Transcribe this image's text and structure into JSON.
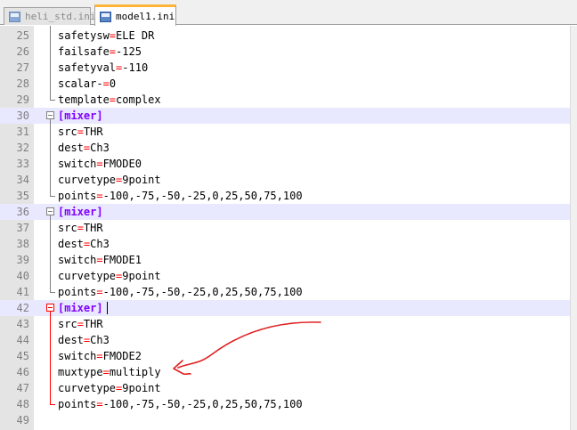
{
  "tabs": [
    {
      "label": "heli_std.ini",
      "active": false,
      "icon": "save-file-icon"
    },
    {
      "label": "model1.ini",
      "active": true,
      "icon": "save-file-icon"
    }
  ],
  "lines": [
    {
      "n": "25",
      "key": "safetysw",
      "val": "ELE DR"
    },
    {
      "n": "26",
      "key": "failsafe",
      "val": "-125"
    },
    {
      "n": "27",
      "key": "safetyval",
      "val": "-110"
    },
    {
      "n": "28",
      "key": "scalar-",
      "val": "0"
    },
    {
      "n": "29",
      "key": "template",
      "val": "complex"
    },
    {
      "n": "30",
      "section": "[mixer]"
    },
    {
      "n": "31",
      "key": "src",
      "val": "THR"
    },
    {
      "n": "32",
      "key": "dest",
      "val": "Ch3"
    },
    {
      "n": "33",
      "key": "switch",
      "val": "FMODE0"
    },
    {
      "n": "34",
      "key": "curvetype",
      "val": "9point"
    },
    {
      "n": "35",
      "key": "points",
      "val": "-100,-75,-50,-25,0,25,50,75,100"
    },
    {
      "n": "36",
      "section": "[mixer]"
    },
    {
      "n": "37",
      "key": "src",
      "val": "THR"
    },
    {
      "n": "38",
      "key": "dest",
      "val": "Ch3"
    },
    {
      "n": "39",
      "key": "switch",
      "val": "FMODE1"
    },
    {
      "n": "40",
      "key": "curvetype",
      "val": "9point"
    },
    {
      "n": "41",
      "key": "points",
      "val": "-100,-75,-50,-25,0,25,50,75,100"
    },
    {
      "n": "42",
      "section": "[mixer]"
    },
    {
      "n": "43",
      "key": "src",
      "val": "THR"
    },
    {
      "n": "44",
      "key": "dest",
      "val": "Ch3"
    },
    {
      "n": "45",
      "key": "switch",
      "val": "FMODE2"
    },
    {
      "n": "46",
      "key": "muxtype",
      "val": "multiply"
    },
    {
      "n": "47",
      "key": "curvetype",
      "val": "9point"
    },
    {
      "n": "48",
      "key": "points",
      "val": "-100,-75,-50,-25,0,25,50,75,100"
    },
    {
      "n": "49"
    }
  ],
  "colors": {
    "key": "#000000",
    "equals": "#ff0000",
    "section": "#8000ff",
    "line_number": "#808080",
    "annotation": "#e02020",
    "active_tab_accent": "#ffb43c"
  },
  "annotation": {
    "type": "hand-drawn-arrow",
    "points_to_line": "46"
  }
}
